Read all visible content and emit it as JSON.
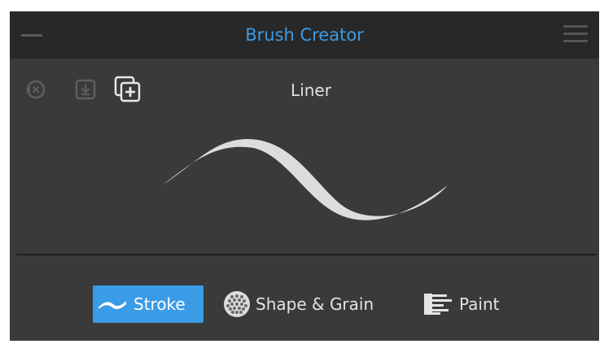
{
  "window": {
    "title": "Brush Creator",
    "collapse_icon": "minus-icon",
    "menu_icon": "hamburger-menu-icon"
  },
  "toolbar": {
    "reset_icon": "reset-brush-icon",
    "save_icon": "save-download-icon",
    "duplicate_icon": "duplicate-brush-icon"
  },
  "brush": {
    "name": "Liner"
  },
  "tabs": [
    {
      "label": "Stroke",
      "icon": "stroke-icon",
      "active": true
    },
    {
      "label": "Shape & Grain",
      "icon": "grain-icon",
      "active": false
    },
    {
      "label": "Paint",
      "icon": "paint-icon",
      "active": false
    }
  ],
  "colors": {
    "accent": "#3a9be6",
    "panel_bg": "#3a3a3a",
    "titlebar_bg": "#282828"
  }
}
